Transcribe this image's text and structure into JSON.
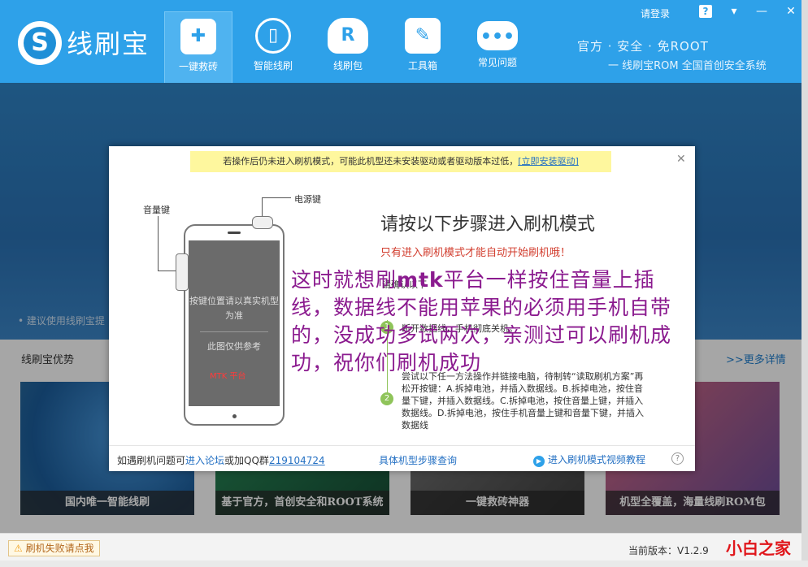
{
  "header": {
    "logo_letter": "S",
    "logo_text": "线刷宝",
    "nav": [
      {
        "label": "一键救砖",
        "icon": "shield-plus-icon"
      },
      {
        "label": "智能线刷",
        "icon": "phone-refresh-icon"
      },
      {
        "label": "线刷包",
        "icon": "cloud-download-icon"
      },
      {
        "label": "工具箱",
        "icon": "wrench-icon"
      },
      {
        "label": "常见问题",
        "icon": "chat-bubble-icon"
      }
    ],
    "login": "请登录",
    "slogan1": "官方 · 安全 · 免ROOT",
    "slogan2": "一 线刷宝ROM 全国首创安全系统",
    "help_glyph": "?",
    "menu_glyph": "▾",
    "min_glyph": "—",
    "close_glyph": "✕"
  },
  "banner": {
    "tip": "• 建议使用线刷宝提"
  },
  "section": {
    "title": "线刷宝优势",
    "more": ">>更多详情",
    "cards": [
      {
        "caption": "国内唯一智能线刷"
      },
      {
        "caption": "基于官方，首创安全和ROOT系统"
      },
      {
        "caption": "一键救砖神器"
      },
      {
        "caption": "机型全覆盖，海量线刷ROM包"
      }
    ]
  },
  "modal": {
    "warning_text": "若操作后仍未进入刷机模式，可能此机型还未安装驱动或者驱动版本过低，",
    "warning_link": "[立即安装驱动]",
    "close_glyph": "✕",
    "volume_key_label": "音量键",
    "power_key_label": "电源键",
    "screen_text1": "按键位置请以真实机型为准",
    "screen_text2": "此图仅供参考",
    "screen_red": "MTK 平台",
    "title": "请按以下步骤进入刷机模式",
    "subtitle": "只有进入刷机模式才能自动开始刷机哦！",
    "steps_header": "请确认以下",
    "step1_num": "1",
    "step1": "断开数据线，手机彻底关机。",
    "step2_num": "2",
    "step2": "尝试以下任一方法操作并链接电脑，待制转“读取刷机方案”再松开按键：A.拆掉电池，并插入数据线。B.拆掉电池，按住音量下键，并插入数据线。C.拆掉电池，按住音量上键，并插入数据线。D.拆掉电池，按住手机音量上键和音量下键，并插入数据线",
    "annotation_1": "这时就想刷",
    "annotation_en": "mtk",
    "annotation_2": "平台一样按住音量上插线，数据线不能用苹果的必须用手机自带的，没成功多试两次，亲测过可以刷机成功，祝你们刷机成功",
    "footer_prefix": "如遇刷机问题可",
    "footer_forum": "进入论坛",
    "footer_or": "或加QQ群",
    "footer_qq": "219104724",
    "footer_mid": "具体机型步骤查询",
    "footer_video": "进入刷机模式视频教程",
    "footer_help": "?"
  },
  "status": {
    "fail_button": "刷机失败请点我",
    "version": "当前版本：V1.2.9",
    "watermark": "小白之家"
  },
  "colors": {
    "brand_blue": "#2ea1e9",
    "annotation_purple": "#8b1b8f",
    "warning_yellow": "#fef79e",
    "step_green": "#8fc45a"
  }
}
